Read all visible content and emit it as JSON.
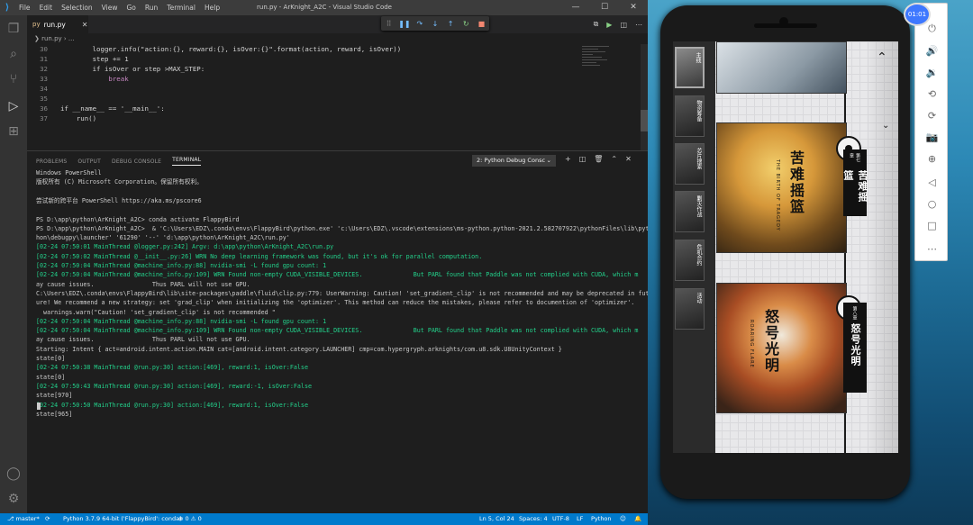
{
  "vscode": {
    "menu": [
      "File",
      "Edit",
      "Selection",
      "View",
      "Go",
      "Run",
      "Terminal",
      "Help"
    ],
    "title": "run.py - ArKnight_A2C - Visual Studio Code",
    "controls": {
      "minimize": "—",
      "maximize": "☐",
      "close": "✕"
    },
    "tab": {
      "icon": "py",
      "label": "run.py",
      "close": "✕"
    },
    "breadcrumb": "❯ run.py › ...",
    "code_lines": [
      {
        "num": "30",
        "text": "        logger.info(\"action:{}, reward:{}, isOver:{}\".format(action, reward, isOver))"
      },
      {
        "num": "31",
        "text": "        step += 1"
      },
      {
        "num": "32",
        "text": "        if isOver or step >MAX_STEP:"
      },
      {
        "num": "33",
        "text": "            break"
      },
      {
        "num": "34",
        "text": ""
      },
      {
        "num": "35",
        "text": ""
      },
      {
        "num": "36",
        "text": "if __name__ == '__main__':"
      },
      {
        "num": "37",
        "text": "    run()"
      }
    ],
    "panel": {
      "tabs": [
        "PROBLEMS",
        "OUTPUT",
        "DEBUG CONSOLE",
        "TERMINAL"
      ],
      "terminal_select": "2: Python Debug Consc",
      "select_chevron": "⌄",
      "actions": [
        "+",
        "◫",
        "🗑",
        "⌃",
        "✕"
      ]
    },
    "terminal_lines": [
      "Windows PowerShell",
      "版权所有 (C) Microsoft Corporation。保留所有权利。",
      "",
      "尝试新的跨平台 PowerShell https://aka.ms/pscore6",
      "",
      "PS D:\\app\\python\\ArKnight_A2C> conda activate FlappyBird",
      "PS D:\\app\\python\\ArKnight_A2C>  & 'C:\\Users\\EDZ\\.conda\\envs\\FlappyBird\\python.exe' 'c:\\Users\\EDZ\\.vscode\\extensions\\ms-python.python-2021.2.582707922\\pythonFiles\\lib\\pyt",
      "hon\\debugpy\\launcher' '61290' '--' 'd:\\app\\python\\ArKnight_A2C\\run.py'",
      "[02-24 07:50:01 MainThread @logger.py:242] Argv: d:\\app\\python\\ArKnight_A2C\\run.py",
      "[02-24 07:50:02 MainThread @__init__.py:26] WRN No deep learning framework was found, but it's ok for parallel computation.",
      "[02-24 07:50:04 MainThread @machine_info.py:88] nvidia-smi -L found gpu count: 1",
      "[02-24 07:50:04 MainThread @machine_info.py:109] WRN Found non-empty CUDA_VISIBLE_DEVICES.              But PARL found that Paddle was not complied with CUDA, which m",
      "ay cause issues.                Thus PARL will not use GPU.",
      "C:\\Users\\EDZ\\.conda\\envs\\FlappyBird\\lib\\site-packages\\paddle\\fluid\\clip.py:779: UserWarning: Caution! 'set_gradient_clip' is not recommended and may be deprecated in fut",
      "ure! We recommend a new strategy: set 'grad_clip' when initializing the 'optimizer'. This method can reduce the mistakes, please refer to documention of 'optimizer'.",
      "  warnings.warn(\"Caution! 'set_gradient_clip' is not recommended \"",
      "[02-24 07:50:04 MainThread @machine_info.py:88] nvidia-smi -L found gpu count: 1",
      "[02-24 07:50:04 MainThread @machine_info.py:109] WRN Found non-empty CUDA_VISIBLE_DEVICES.              But PARL found that Paddle was not complied with CUDA, which m",
      "ay cause issues.                Thus PARL will not use GPU.",
      "Starting: Intent { act=android.intent.action.MAIN cat=[android.intent.category.LAUNCHER] cmp=com.hypergryph.arknights/com.u8.sdk.U8UnityContext }",
      "state[0]",
      "[02-24 07:50:38 MainThread @run.py:30] action:[469], reward:1, isOver:False",
      "state[0]",
      "[02-24 07:50:43 MainThread @run.py:30] action:[469], reward:-1, isOver:False",
      "state[970]",
      "[02-24 07:50:50 MainThread @run.py:30] action:[469], reward:1, isOver:False",
      "state[965]"
    ],
    "status": {
      "branch": "⎇ master*",
      "sync": "⟳",
      "interpreter": "Python 3.7.9 64-bit ('FlappyBird': conda)",
      "problems": "⊗ 0 ⚠ 0",
      "position": "Ln 5, Col 24",
      "spaces": "Spaces: 4",
      "encoding": "UTF-8",
      "eol": "LF",
      "language": "Python",
      "feedback": "☺",
      "bell": "🔔"
    }
  },
  "emulator": {
    "clock": "01:01",
    "thumbnails": [
      "主线",
      "物资筹备",
      "芯片搜索",
      "剿灭作战",
      "危机合约",
      "活动"
    ],
    "episodes": [
      {
        "tag": "第七章",
        "title": "苦难摇篮",
        "en": "THE BIRTH OF TRAGEDY"
      },
      {
        "tag": "第八章",
        "title": "怒号光明",
        "en": "ROARING FLARE"
      }
    ],
    "toolbar_icons": [
      "power-icon",
      "volume-up-icon",
      "volume-down-icon",
      "rotate-left-icon",
      "rotate-right-icon",
      "camera-icon",
      "zoom-icon",
      "back-icon",
      "home-icon",
      "overview-icon",
      "more-icon"
    ]
  },
  "colors": {
    "accent": "#007acc",
    "green": "#23d18b",
    "yellow": "#e5e510",
    "cyan": "#29b8db"
  }
}
